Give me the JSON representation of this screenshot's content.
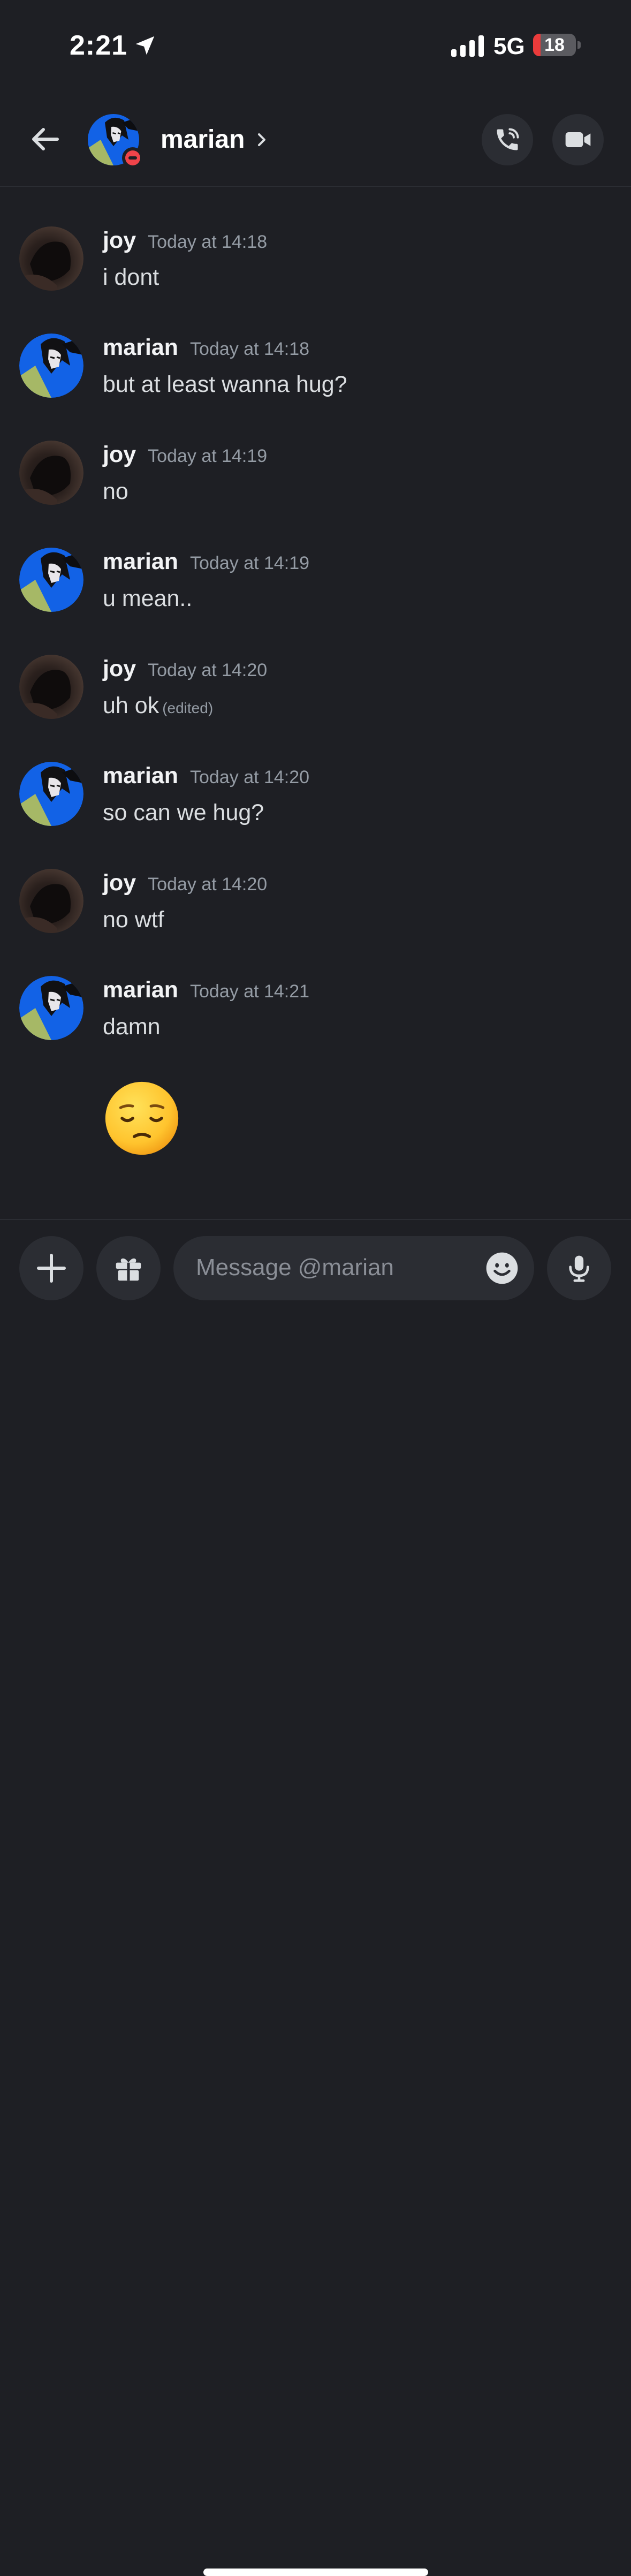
{
  "status_bar": {
    "time": "2:21",
    "network": "5G",
    "battery": "18",
    "battery_level": 0.18
  },
  "header": {
    "name": "marian",
    "status": "do-not-disturb"
  },
  "messages": [
    {
      "author": "joy",
      "time": "Today at 14:18",
      "text": "i dont",
      "edited": ""
    },
    {
      "author": "marian",
      "time": "Today at 14:18",
      "text": "but at least wanna hug?",
      "edited": ""
    },
    {
      "author": "joy",
      "time": "Today at 14:19",
      "text": "no",
      "edited": ""
    },
    {
      "author": "marian",
      "time": "Today at 14:19",
      "text": "u mean..",
      "edited": ""
    },
    {
      "author": "joy",
      "time": "Today at 14:20",
      "text": "uh ok",
      "edited": "(edited)"
    },
    {
      "author": "marian",
      "time": "Today at 14:20",
      "text": "so can we hug?",
      "edited": ""
    },
    {
      "author": "joy",
      "time": "Today at 14:20",
      "text": "no wtf",
      "edited": ""
    },
    {
      "author": "marian",
      "time": "Today at 14:21",
      "text": "damn",
      "edited": ""
    }
  ],
  "emoji_message": "pensive-face-emoji",
  "composer": {
    "placeholder": "Message @marian"
  },
  "colors": {
    "background": "#1e1f24",
    "surface": "#2b2d33",
    "timestamp": "#949ba4",
    "dnd_red": "#f0444a"
  }
}
